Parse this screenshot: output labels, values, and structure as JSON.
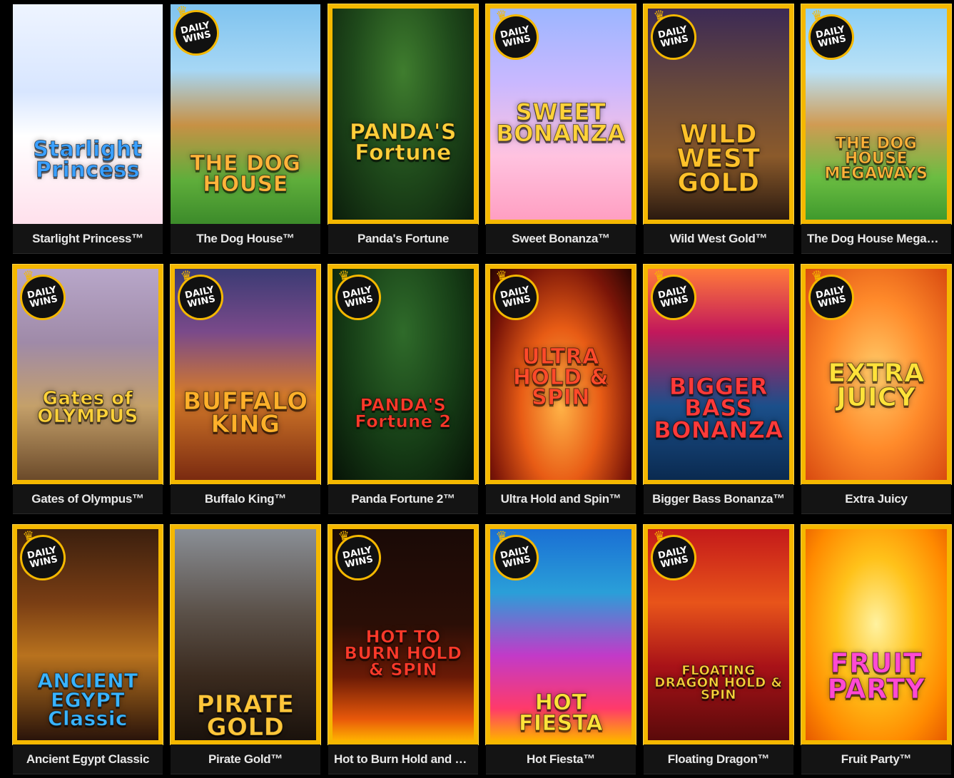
{
  "badge_text": "DAILY\nWINS",
  "games": [
    {
      "title": "Starlight Princess™",
      "logo": "Starlight Princess",
      "logo_color": "#3aa0ff",
      "framed": false,
      "badge": false,
      "bg": "bg-starlight"
    },
    {
      "title": "The Dog House™",
      "logo": "THE DOG HOUSE",
      "logo_color": "#ffb43a",
      "framed": false,
      "badge": true,
      "bg": "bg-doghouse"
    },
    {
      "title": "Panda's Fortune",
      "logo": "PANDA'S Fortune",
      "logo_color": "#ffcf3a",
      "framed": true,
      "badge": false,
      "bg": "bg-panda"
    },
    {
      "title": "Sweet Bonanza™",
      "logo": "SWEET BONANZA",
      "logo_color": "#ffd23a",
      "framed": true,
      "badge": true,
      "bg": "bg-sweet"
    },
    {
      "title": "Wild West Gold™",
      "logo": "WILD WEST GOLD",
      "logo_color": "#ffc12a",
      "framed": true,
      "badge": true,
      "bg": "bg-wildwest"
    },
    {
      "title": "The Dog House Megaways™",
      "logo": "THE DOG HOUSE MEGAWAYS",
      "logo_color": "#ffb43a",
      "framed": true,
      "badge": true,
      "bg": "bg-doghouse-mega"
    },
    {
      "title": "Gates of Olympus™",
      "logo": "Gates of OLYMPUS",
      "logo_color": "#ffd23a",
      "framed": true,
      "badge": true,
      "bg": "bg-olympus"
    },
    {
      "title": "Buffalo King™",
      "logo": "BUFFALO KING",
      "logo_color": "#ffb02a",
      "framed": true,
      "badge": true,
      "bg": "bg-buffalo"
    },
    {
      "title": "Panda Fortune 2™",
      "logo": "PANDA'S Fortune 2",
      "logo_color": "#ff3a2a",
      "framed": true,
      "badge": true,
      "bg": "bg-panda2"
    },
    {
      "title": "Ultra Hold and Spin™",
      "logo": "ULTRA HOLD & SPIN",
      "logo_color": "#ff4a2a",
      "framed": true,
      "badge": true,
      "bg": "bg-ultra"
    },
    {
      "title": "Bigger Bass Bonanza™",
      "logo": "BIGGER BASS BONANZA",
      "logo_color": "#ff3a3a",
      "framed": true,
      "badge": true,
      "bg": "bg-bigger"
    },
    {
      "title": "Extra Juicy",
      "logo": "EXTRA JUICY",
      "logo_color": "#ffe23a",
      "framed": true,
      "badge": true,
      "bg": "bg-juicy"
    },
    {
      "title": "Ancient Egypt Classic",
      "logo": "ANCIENT EGYPT Classic",
      "logo_color": "#3ab4ff",
      "framed": true,
      "badge": true,
      "bg": "bg-egypt"
    },
    {
      "title": "Pirate Gold™",
      "logo": "PIRATE GOLD",
      "logo_color": "#ffc63a",
      "framed": true,
      "badge": false,
      "bg": "bg-pirate"
    },
    {
      "title": "Hot to Burn Hold and Spin™",
      "logo": "HOT TO BURN HOLD & SPIN",
      "logo_color": "#ff3a2a",
      "framed": true,
      "badge": true,
      "bg": "bg-hotburn"
    },
    {
      "title": "Hot Fiesta™",
      "logo": "HOT FIESTA",
      "logo_color": "#ffe23a",
      "framed": true,
      "badge": true,
      "bg": "bg-fiesta"
    },
    {
      "title": "Floating Dragon™",
      "logo": "FLOATING DRAGON HOLD & SPIN",
      "logo_color": "#ffd23a",
      "framed": true,
      "badge": true,
      "bg": "bg-dragon"
    },
    {
      "title": "Fruit Party™",
      "logo": "FRUIT PARTY",
      "logo_color": "#ff4ad2",
      "framed": true,
      "badge": false,
      "bg": "bg-fruit"
    }
  ]
}
